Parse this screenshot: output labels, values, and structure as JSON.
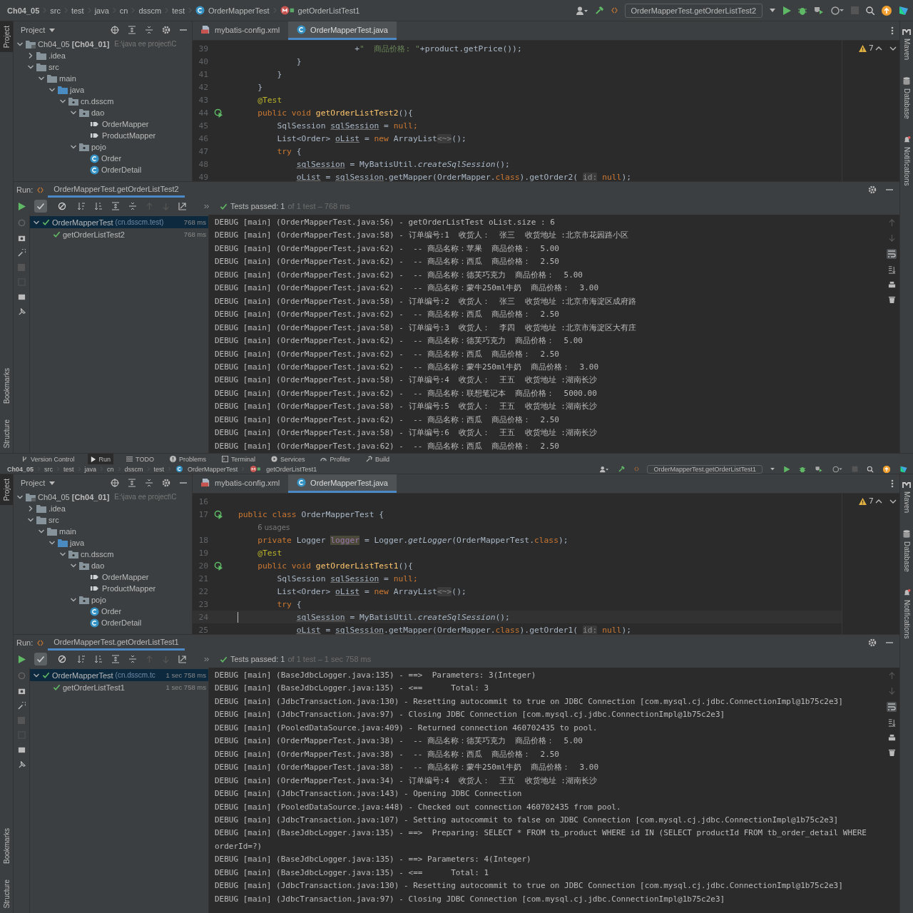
{
  "windows": [
    {
      "breadcrumb": [
        {
          "label": "Ch04_05",
          "kind": "project"
        },
        {
          "label": "src",
          "kind": "folder"
        },
        {
          "label": "test",
          "kind": "folder"
        },
        {
          "label": "java",
          "kind": "folder"
        },
        {
          "label": "cn",
          "kind": "folder"
        },
        {
          "label": "dsscm",
          "kind": "folder"
        },
        {
          "label": "test",
          "kind": "folder"
        },
        {
          "label": "OrderMapperTest",
          "kind": "class"
        },
        {
          "label": "getOrderListTest1",
          "kind": "method"
        }
      ],
      "run_config": "OrderMapperTest.getOrderListTest2",
      "left_stripe": {
        "top": [
          {
            "label": "Project",
            "selected": true
          }
        ],
        "bottom": [
          {
            "label": "Bookmarks",
            "selected": false
          },
          {
            "label": "Structure",
            "selected": false
          }
        ]
      },
      "right_stripe": [
        {
          "label": "Maven",
          "kind": "maven"
        },
        {
          "label": "Database",
          "kind": "database"
        },
        {
          "label": "Notifications",
          "kind": "bell"
        }
      ],
      "project_panel": {
        "title": "Project",
        "tree": [
          {
            "label": "Ch04_05 **[Ch04_01]**",
            "path": "E:\\java ee project\\C",
            "kind": "module",
            "expanded": true,
            "children": [
              {
                "label": ".idea",
                "kind": "folder",
                "expanded": false
              },
              {
                "label": "src",
                "kind": "folder",
                "expanded": true,
                "children": [
                  {
                    "label": "main",
                    "kind": "folder",
                    "expanded": true,
                    "children": [
                      {
                        "label": "java",
                        "kind": "source",
                        "expanded": true,
                        "children": [
                          {
                            "label": "cn.dsscm",
                            "kind": "package",
                            "expanded": true,
                            "children": [
                              {
                                "label": "dao",
                                "kind": "package",
                                "expanded": true,
                                "children": [
                                  {
                                    "label": "OrderMapper",
                                    "kind": "mapper"
                                  },
                                  {
                                    "label": "ProductMapper",
                                    "kind": "mapper"
                                  }
                                ]
                              },
                              {
                                "label": "pojo",
                                "kind": "package",
                                "expanded": true,
                                "children": [
                                  {
                                    "label": "Order",
                                    "kind": "class"
                                  },
                                  {
                                    "label": "OrderDetail",
                                    "kind": "class"
                                  }
                                ]
                              }
                            ]
                          }
                        ]
                      }
                    ]
                  }
                ]
              }
            ]
          }
        ]
      },
      "editor": {
        "tabs": [
          {
            "label": "mybatis-config.xml",
            "kind": "xml",
            "selected": false
          },
          {
            "label": "OrderMapperTest.java",
            "kind": "class",
            "selected": true
          }
        ],
        "warnings": "7",
        "lines": [
          {
            "number": "39",
            "run_icon": false,
            "current": false,
            "tokens": [
              {
                "text": "                        +",
                "kind": "plain"
              },
              {
                "text": "\"  商品价格: \"",
                "kind": "str"
              },
              {
                "text": "+product.getPrice());",
                "kind": "plain"
              }
            ]
          },
          {
            "number": "40",
            "run_icon": false,
            "current": false,
            "tokens": [
              {
                "text": "            }",
                "kind": "plain"
              }
            ]
          },
          {
            "number": "41",
            "run_icon": false,
            "current": false,
            "tokens": [
              {
                "text": "        }",
                "kind": "plain"
              }
            ]
          },
          {
            "number": "42",
            "run_icon": false,
            "current": false,
            "tokens": [
              {
                "text": "    }",
                "kind": "plain"
              }
            ]
          },
          {
            "number": "43",
            "run_icon": false,
            "current": false,
            "tokens": [
              {
                "text": "    @Test",
                "kind": "anno"
              }
            ]
          },
          {
            "number": "44",
            "run_icon": true,
            "current": false,
            "tokens": [
              {
                "text": "    public void ",
                "kind": "kw"
              },
              {
                "text": "getOrderListTest2",
                "kind": "fn"
              },
              {
                "text": "(){",
                "kind": "plain"
              }
            ]
          },
          {
            "number": "45",
            "run_icon": false,
            "current": false,
            "tokens": [
              {
                "text": "        SqlSession ",
                "kind": "plain"
              },
              {
                "text": "sqlSession",
                "kind": "var"
              },
              {
                "text": " = ",
                "kind": "plain"
              },
              {
                "text": "null",
                "kind": "kw"
              },
              {
                "text": ";",
                "kind": "kw"
              }
            ]
          },
          {
            "number": "46",
            "run_icon": false,
            "current": false,
            "tokens": [
              {
                "text": "        List<Order> ",
                "kind": "plain"
              },
              {
                "text": "oList",
                "kind": "var"
              },
              {
                "text": " = ",
                "kind": "plain"
              },
              {
                "text": "new",
                "kind": "kw"
              },
              {
                "text": " ArrayList",
                "kind": "plain"
              },
              {
                "text": "<~>",
                "kind": "hint"
              },
              {
                "text": "();",
                "kind": "plain"
              }
            ]
          },
          {
            "number": "47",
            "run_icon": false,
            "current": false,
            "tokens": [
              {
                "text": "        try",
                "kind": "kw"
              },
              {
                "text": " {",
                "kind": "plain"
              }
            ]
          },
          {
            "number": "48",
            "run_icon": false,
            "current": false,
            "tokens": [
              {
                "text": "            sqlSession",
                "kind": "var"
              },
              {
                "text": " = MyBatisUtil.",
                "kind": "plain"
              },
              {
                "text": "createSqlSession",
                "kind": "italic"
              },
              {
                "text": "();",
                "kind": "plain"
              }
            ]
          },
          {
            "number": "49",
            "run_icon": false,
            "current": false,
            "tokens": [
              {
                "text": "            oList",
                "kind": "var"
              },
              {
                "text": " = ",
                "kind": "plain"
              },
              {
                "text": "sqlSession",
                "kind": "var"
              },
              {
                "text": ".getMapper(OrderMapper.",
                "kind": "plain"
              },
              {
                "text": "class",
                "kind": "kw"
              },
              {
                "text": ").getOrder2( ",
                "kind": "plain"
              },
              {
                "text": "id:",
                "kind": "hint"
              },
              {
                "text": " null",
                "kind": "kw"
              },
              {
                "text": ");",
                "kind": "plain"
              }
            ]
          }
        ]
      },
      "run": {
        "label": "Run:",
        "tab": "OrderMapperTest.getOrderListTest2",
        "filters": [
          {
            "kind": "passed",
            "on": true
          },
          {
            "kind": "ignored",
            "on": false
          }
        ],
        "status": "Tests passed: 1",
        "status_detail": "of 1 test – 768 ms",
        "tests": [
          {
            "name": "OrderMapperTest",
            "detail": "(cn.dsscm.test)",
            "time": "768 ms",
            "passed": true,
            "selected": true,
            "children": [
              {
                "name": "getOrderListTest2",
                "time": "768 ms",
                "passed": true,
                "selected": false
              }
            ]
          }
        ],
        "console": [
          "DEBUG [main] (OrderMapperTest.java:56) - getOrderListTest oList.size : 6",
          "DEBUG [main] (OrderMapperTest.java:58) - 订单编号:1  收货人：  张三  收货地址 :北京市花园路小区",
          "DEBUG [main] (OrderMapperTest.java:62) -  -- 商品名称：苹果  商品价格：  5.00",
          "DEBUG [main] (OrderMapperTest.java:62) -  -- 商品名称：西瓜  商品价格：  2.50",
          "DEBUG [main] (OrderMapperTest.java:62) -  -- 商品名称：德芙巧克力  商品价格：  5.00",
          "DEBUG [main] (OrderMapperTest.java:62) -  -- 商品名称：蒙牛250ml牛奶  商品价格：  3.00",
          "DEBUG [main] (OrderMapperTest.java:58) - 订单编号:2  收货人：  张三  收货地址 :北京市海淀区成府路",
          "DEBUG [main] (OrderMapperTest.java:62) -  -- 商品名称：西瓜  商品价格：  2.50",
          "DEBUG [main] (OrderMapperTest.java:58) - 订单编号:3  收货人：  李四  收货地址 :北京市海淀区大有庄",
          "DEBUG [main] (OrderMapperTest.java:62) -  -- 商品名称：德芙巧克力  商品价格：  5.00",
          "DEBUG [main] (OrderMapperTest.java:62) -  -- 商品名称：西瓜  商品价格：  2.50",
          "DEBUG [main] (OrderMapperTest.java:62) -  -- 商品名称：蒙牛250ml牛奶  商品价格：  3.00",
          "DEBUG [main] (OrderMapperTest.java:58) - 订单编号:4  收货人：  王五  收货地址 :湖南长沙",
          "DEBUG [main] (OrderMapperTest.java:62) -  -- 商品名称：联想笔记本  商品价格：  5000.00",
          "DEBUG [main] (OrderMapperTest.java:58) - 订单编号:5  收货人：  王五  收货地址 :湖南长沙",
          "DEBUG [main] (OrderMapperTest.java:62) -  -- 商品名称：西瓜  商品价格：  2.50",
          "DEBUG [main] (OrderMapperTest.java:58) - 订单编号:6  收货人：  王五  收货地址 :湖南长沙",
          "DEBUG [main] (OrderMapperTest.java:62) -  -- 商品名称：西瓜  商品价格：  2.50"
        ]
      }
    },
    {
      "breadcrumb": [
        {
          "label": "Ch04_05",
          "kind": "project"
        },
        {
          "label": "src",
          "kind": "folder"
        },
        {
          "label": "test",
          "kind": "folder"
        },
        {
          "label": "java",
          "kind": "folder"
        },
        {
          "label": "cn",
          "kind": "folder"
        },
        {
          "label": "dsscm",
          "kind": "folder"
        },
        {
          "label": "test",
          "kind": "folder"
        },
        {
          "label": "OrderMapperTest",
          "kind": "class"
        },
        {
          "label": "getOrderListTest1",
          "kind": "method"
        }
      ],
      "run_config": "OrderMapperTest.getOrderListTest1",
      "left_stripe": {
        "top": [
          {
            "label": "Project",
            "selected": true
          }
        ],
        "bottom": [
          {
            "label": "Bookmarks",
            "selected": false
          },
          {
            "label": "Structure",
            "selected": false
          }
        ]
      },
      "right_stripe": [
        {
          "label": "Maven",
          "kind": "maven"
        },
        {
          "label": "Database",
          "kind": "database"
        },
        {
          "label": "Notifications",
          "kind": "bell"
        }
      ],
      "project_panel": {
        "title": "Project",
        "tree": [
          {
            "label": "Ch04_05 **[Ch04_01]**",
            "path": "E:\\java ee project\\C",
            "kind": "module",
            "expanded": true,
            "children": [
              {
                "label": ".idea",
                "kind": "folder",
                "expanded": false
              },
              {
                "label": "src",
                "kind": "folder",
                "expanded": true,
                "children": [
                  {
                    "label": "main",
                    "kind": "folder",
                    "expanded": true,
                    "children": [
                      {
                        "label": "java",
                        "kind": "source",
                        "expanded": true,
                        "children": [
                          {
                            "label": "cn.dsscm",
                            "kind": "package",
                            "expanded": true,
                            "children": [
                              {
                                "label": "dao",
                                "kind": "package",
                                "expanded": true,
                                "children": [
                                  {
                                    "label": "OrderMapper",
                                    "kind": "mapper"
                                  },
                                  {
                                    "label": "ProductMapper",
                                    "kind": "mapper"
                                  }
                                ]
                              },
                              {
                                "label": "pojo",
                                "kind": "package",
                                "expanded": true,
                                "children": [
                                  {
                                    "label": "Order",
                                    "kind": "class"
                                  },
                                  {
                                    "label": "OrderDetail",
                                    "kind": "class"
                                  }
                                ]
                              }
                            ]
                          }
                        ]
                      }
                    ]
                  }
                ]
              }
            ]
          }
        ]
      },
      "editor": {
        "tabs": [
          {
            "label": "mybatis-config.xml",
            "kind": "xml",
            "selected": false
          },
          {
            "label": "OrderMapperTest.java",
            "kind": "class",
            "selected": true
          }
        ],
        "warnings": "7",
        "lines": [
          {
            "number": "16",
            "run_icon": false,
            "current": false
          },
          {
            "number": "17",
            "run_icon": true,
            "current": false,
            "tokens": [
              {
                "text": "public class ",
                "kind": "kw"
              },
              {
                "text": "OrderMapperTest {",
                "kind": "plain"
              }
            ]
          },
          {
            "run_icon": false,
            "current": false,
            "tokens": [
              {
                "text": "    6 usages",
                "kind": "usages"
              }
            ]
          },
          {
            "number": "18",
            "run_icon": false,
            "current": false,
            "tokens": [
              {
                "text": "    private ",
                "kind": "kw"
              },
              {
                "text": "Logger ",
                "kind": "plain"
              },
              {
                "text": "logger",
                "kind": "field"
              },
              {
                "text": " = Logger.",
                "kind": "plain"
              },
              {
                "text": "getLogger",
                "kind": "italic"
              },
              {
                "text": "(OrderMapperTest.",
                "kind": "plain"
              },
              {
                "text": "class",
                "kind": "kw"
              },
              {
                "text": ");",
                "kind": "plain"
              }
            ]
          },
          {
            "number": "19",
            "run_icon": false,
            "current": false,
            "tokens": [
              {
                "text": "    @Test",
                "kind": "anno"
              }
            ]
          },
          {
            "number": "20",
            "run_icon": true,
            "current": false,
            "tokens": [
              {
                "text": "    public void ",
                "kind": "kw"
              },
              {
                "text": "getOrderListTest1",
                "kind": "fn"
              },
              {
                "text": "(){",
                "kind": "plain"
              }
            ]
          },
          {
            "number": "21",
            "run_icon": false,
            "current": false,
            "tokens": [
              {
                "text": "        SqlSession ",
                "kind": "plain"
              },
              {
                "text": "sqlSession",
                "kind": "var"
              },
              {
                "text": " = ",
                "kind": "plain"
              },
              {
                "text": "null",
                "kind": "kw"
              },
              {
                "text": ";",
                "kind": "kw"
              }
            ]
          },
          {
            "number": "22",
            "run_icon": false,
            "current": false,
            "tokens": [
              {
                "text": "        List<Order> ",
                "kind": "plain"
              },
              {
                "text": "oList",
                "kind": "var"
              },
              {
                "text": " = ",
                "kind": "plain"
              },
              {
                "text": "new",
                "kind": "kw"
              },
              {
                "text": " ArrayList",
                "kind": "plain"
              },
              {
                "text": "<~>",
                "kind": "hint"
              },
              {
                "text": "();",
                "kind": "plain"
              }
            ]
          },
          {
            "number": "23",
            "run_icon": false,
            "current": false,
            "tokens": [
              {
                "text": "        try",
                "kind": "kw"
              },
              {
                "text": " {",
                "kind": "plain"
              }
            ]
          },
          {
            "number": "24",
            "run_icon": false,
            "current": true,
            "tokens": [
              {
                "text": "            sqlSession",
                "kind": "var"
              },
              {
                "text": " = MyBatisUtil.",
                "kind": "plain"
              },
              {
                "text": "createSqlSession",
                "kind": "italic"
              },
              {
                "text": "();",
                "kind": "plain"
              }
            ]
          },
          {
            "number": "25",
            "run_icon": false,
            "current": false,
            "tokens": [
              {
                "text": "            oList",
                "kind": "var"
              },
              {
                "text": " = ",
                "kind": "plain"
              },
              {
                "text": "sqlSession",
                "kind": "var"
              },
              {
                "text": ".getMapper(OrderMapper.",
                "kind": "plain"
              },
              {
                "text": "class",
                "kind": "kw"
              },
              {
                "text": ").getOrder1( ",
                "kind": "plain"
              },
              {
                "text": "id:",
                "kind": "hint"
              },
              {
                "text": " null",
                "kind": "kw"
              },
              {
                "text": ");",
                "kind": "plain"
              }
            ]
          }
        ]
      },
      "run": {
        "label": "Run:",
        "tab": "OrderMapperTest.getOrderListTest1",
        "filters": [
          {
            "kind": "passed",
            "on": true
          },
          {
            "kind": "ignored",
            "on": false
          }
        ],
        "status": "Tests passed: 1",
        "status_detail": "of 1 test – 1 sec 758 ms",
        "tests": [
          {
            "name": "OrderMapperTest",
            "detail": "(cn.dsscm.tc",
            "time": "1 sec 758 ms",
            "passed": true,
            "selected": true,
            "children": [
              {
                "name": "getOrderListTest1",
                "time": "1 sec 758 ms",
                "passed": true,
                "selected": false
              }
            ]
          }
        ],
        "console": [
          "DEBUG [main] (BaseJdbcLogger.java:135) - ==>  Parameters: 3(Integer)",
          "DEBUG [main] (BaseJdbcLogger.java:135) - <==      Total: 3",
          "DEBUG [main] (JdbcTransaction.java:130) - Resetting autocommit to true on JDBC Connection [com.mysql.cj.jdbc.ConnectionImpl@1b75c2e3]",
          "DEBUG [main] (JdbcTransaction.java:97) - Closing JDBC Connection [com.mysql.cj.jdbc.ConnectionImpl@1b75c2e3]",
          "DEBUG [main] (PooledDataSource.java:409) - Returned connection 460702435 to pool.",
          "DEBUG [main] (OrderMapperTest.java:38) -  -- 商品名称：德芙巧克力  商品价格：  5.00",
          "DEBUG [main] (OrderMapperTest.java:38) -  -- 商品名称：西瓜  商品价格：  2.50",
          "DEBUG [main] (OrderMapperTest.java:38) -  -- 商品名称：蒙牛250ml牛奶  商品价格：  3.00",
          "DEBUG [main] (OrderMapperTest.java:34) - 订单编号:4  收货人：  王五  收货地址 :湖南长沙",
          "DEBUG [main] (JdbcTransaction.java:143) - Opening JDBC Connection",
          "DEBUG [main] (PooledDataSource.java:448) - Checked out connection 460702435 from pool.",
          "DEBUG [main] (JdbcTransaction.java:107) - Setting autocommit to false on JDBC Connection [com.mysql.cj.jdbc.ConnectionImpl@1b75c2e3]",
          "DEBUG [main] (BaseJdbcLogger.java:135) - ==>  Preparing: SELECT * FROM tb_product WHERE id IN (SELECT productId FROM tb_order_detail WHERE orderId=?)",
          "DEBUG [main] (BaseJdbcLogger.java:135) - ==> Parameters: 4(Integer)",
          "DEBUG [main] (BaseJdbcLogger.java:135) - <==      Total: 1",
          "DEBUG [main] (JdbcTransaction.java:130) - Resetting autocommit to true on JDBC Connection [com.mysql.cj.jdbc.ConnectionImpl@1b75c2e3]",
          "DEBUG [main] (JdbcTransaction.java:97) - Closing JDBC Connection [com.mysql.cj.jdbc.ConnectionImpl@1b75c2e3]"
        ]
      }
    }
  ],
  "tool_window_bar": [
    {
      "label": "Version Control",
      "kind": "vcs",
      "selected": false
    },
    {
      "label": "Run",
      "kind": "run",
      "selected": true
    },
    {
      "label": "TODO",
      "kind": "todo",
      "selected": false
    },
    {
      "label": "Problems",
      "kind": "problems",
      "selected": false
    },
    {
      "label": "Terminal",
      "kind": "terminal",
      "selected": false
    },
    {
      "label": "Services",
      "kind": "services",
      "selected": false
    },
    {
      "label": "Profiler",
      "kind": "profiler",
      "selected": false
    },
    {
      "label": "Build",
      "kind": "build",
      "selected": false
    }
  ]
}
